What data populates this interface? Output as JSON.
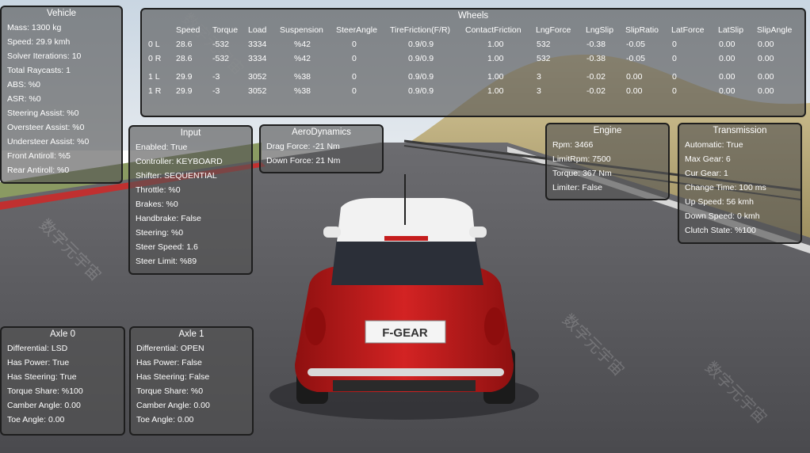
{
  "vehicle": {
    "title": "Vehicle",
    "lines": [
      "Mass: 1300 kg",
      "Speed: 29.9 kmh",
      "Solver Iterations: 10",
      "Total Raycasts: 1",
      "ABS: %0",
      "ASR: %0",
      "Steering Assist: %0",
      "Oversteer Assist: %0",
      "Understeer Assist: %0",
      "Front Antiroll: %5",
      "Rear Antiroll: %0"
    ]
  },
  "wheels": {
    "title": "Wheels",
    "headers": [
      "Speed",
      "Torque",
      "Load",
      "Suspension",
      "SteerAngle",
      "TireFriction(F/R)",
      "ContactFriction",
      "LngForce",
      "LngSlip",
      "SlipRatio",
      "LatForce",
      "LatSlip",
      "SlipAngle"
    ],
    "rows": [
      {
        "name": "0 L",
        "values": [
          "28.6",
          "-532",
          "3334",
          "%42",
          "0",
          "0.9/0.9",
          "1.00",
          "532",
          "-0.38",
          "-0.05",
          "0",
          "0.00",
          "0.00"
        ]
      },
      {
        "name": "0 R",
        "values": [
          "28.6",
          "-532",
          "3334",
          "%42",
          "0",
          "0.9/0.9",
          "1.00",
          "532",
          "-0.38",
          "-0.05",
          "0",
          "0.00",
          "0.00"
        ]
      },
      {
        "name": "1 L",
        "values": [
          "29.9",
          "-3",
          "3052",
          "%38",
          "0",
          "0.9/0.9",
          "1.00",
          "3",
          "-0.02",
          "0.00",
          "0",
          "0.00",
          "0.00"
        ]
      },
      {
        "name": "1 R",
        "values": [
          "29.9",
          "-3",
          "3052",
          "%38",
          "0",
          "0.9/0.9",
          "1.00",
          "3",
          "-0.02",
          "0.00",
          "0",
          "0.00",
          "0.00"
        ]
      }
    ]
  },
  "input": {
    "title": "Input",
    "lines": [
      "Enabled: True",
      "Controller: KEYBOARD",
      "Shifter: SEQUENTIAL",
      "Throttle: %0",
      "Brakes: %0",
      "Handbrake: False",
      "Steering: %0",
      "Steer Speed: 1.6",
      "Steer Limit: %89"
    ]
  },
  "aero": {
    "title": "AeroDynamics",
    "lines": [
      "Drag Force: -21 Nm",
      "Down Force: 21 Nm"
    ]
  },
  "engine": {
    "title": "Engine",
    "lines": [
      "Rpm: 3466",
      "LimitRpm: 7500",
      "Torque: 367 Nm",
      "Limiter: False"
    ]
  },
  "transmission": {
    "title": "Transmission",
    "lines": [
      "Automatic: True",
      "Max Gear: 6",
      "Cur Gear: 1",
      "Change Time: 100 ms",
      "Up Speed: 56 kmh",
      "Down Speed: 0 kmh",
      "Clutch State: %100"
    ]
  },
  "axle0": {
    "title": "Axle 0",
    "lines": [
      "Differential: LSD",
      "Has Power: True",
      "Has Steering: True",
      "Torque Share: %100",
      "Camber Angle: 0.00",
      "Toe Angle: 0.00"
    ]
  },
  "axle1": {
    "title": "Axle 1",
    "lines": [
      "Differential: OPEN",
      "Has Power: False",
      "Has Steering: False",
      "Torque Share: %0",
      "Camber Angle: 0.00",
      "Toe Angle: 0.00"
    ]
  },
  "car": {
    "plate": "F-GEAR",
    "body_color": "#c51d1d",
    "roof_color": "#f2f2f2"
  },
  "colors": {
    "panel_bg": "#525252",
    "panel_border": "#1e1e1e",
    "text": "#ffffff",
    "sky": "#d7e0e8",
    "road": "#505055",
    "hill": "#b9a878"
  },
  "watermark": "数字元宇宙"
}
